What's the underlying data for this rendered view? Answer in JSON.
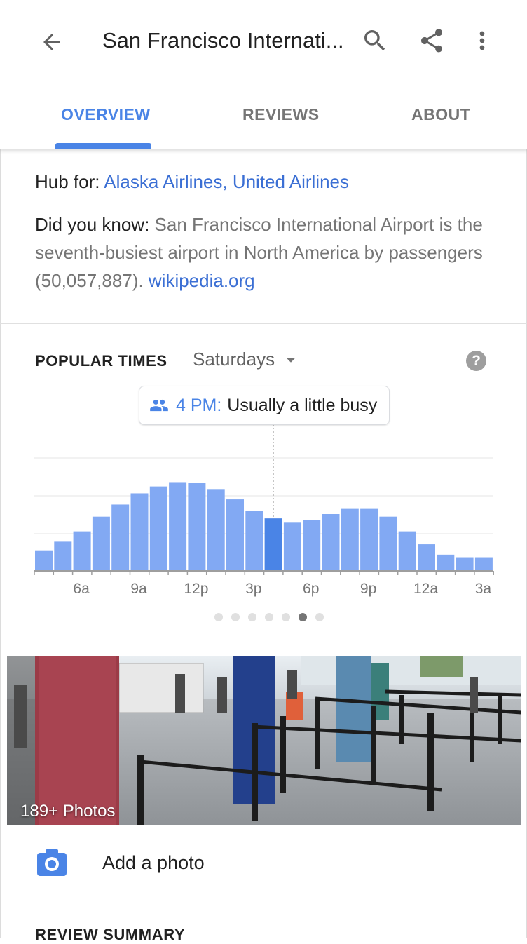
{
  "header": {
    "title": "San Francisco Internati...",
    "back_icon": "arrow-back-icon",
    "search_icon": "search-icon",
    "share_icon": "share-icon",
    "more_icon": "more-vert-icon"
  },
  "tabs": [
    {
      "label": "OVERVIEW",
      "active": true
    },
    {
      "label": "REVIEWS",
      "active": false
    },
    {
      "label": "ABOUT",
      "active": false
    }
  ],
  "info": {
    "hub_label": "Hub for: ",
    "hub_airlines": [
      "Alaska Airlines",
      "United Airlines"
    ],
    "hub_separator": ", ",
    "did_you_know_label": "Did you know: ",
    "did_you_know_text": "San Francisco International Airport is the seventh-busiest airport in North America by passengers (50,057,887). ",
    "source_link": "wikipedia.org"
  },
  "popular_times": {
    "title": "POPULAR TIMES",
    "day": "Saturdays",
    "help": "?",
    "bubble_time": "4 PM:",
    "bubble_status": "Usually a little busy",
    "page_count": 7,
    "current_page": 5
  },
  "chart_data": {
    "type": "bar",
    "categories": [
      "4a",
      "5a",
      "6a",
      "7a",
      "8a",
      "9a",
      "10a",
      "11a",
      "12p",
      "1p",
      "2p",
      "3p",
      "4p",
      "5p",
      "6p",
      "7p",
      "8p",
      "9p",
      "10p",
      "11p",
      "12a",
      "1a",
      "2a",
      "3a",
      "4a"
    ],
    "values": [
      23,
      33,
      45,
      62,
      76,
      89,
      97,
      102,
      101,
      94,
      82,
      69,
      60,
      55,
      58,
      65,
      71,
      71,
      62,
      45,
      30,
      18,
      15,
      15
    ],
    "highlight_index": 12,
    "tick_labels": [
      "6a",
      "9a",
      "12p",
      "3p",
      "6p",
      "9p",
      "12a",
      "3a"
    ],
    "ylim": [
      0,
      130
    ],
    "grid": true,
    "colors": {
      "bar": "#82a9f3",
      "highlight": "#4a84e6",
      "grid": "#e6e6e6"
    }
  },
  "photos": {
    "count_label": "189+ Photos"
  },
  "add_photo": {
    "label": "Add a photo",
    "icon": "camera-icon"
  },
  "review_summary": {
    "title": "REVIEW SUMMARY"
  }
}
